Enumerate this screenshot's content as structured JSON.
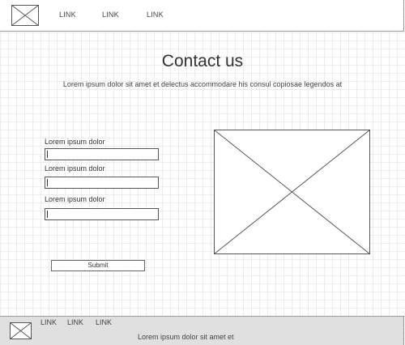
{
  "header": {
    "links": [
      "LINK",
      "LINK",
      "LINK"
    ]
  },
  "main": {
    "title": "Contact us",
    "subtitle": "Lorem ipsum dolor sit amet et delectus accommodare his consul copiosae legendos at",
    "form": {
      "fields": [
        {
          "label": "Lorem ipsum dolor",
          "value": ""
        },
        {
          "label": "Lorem ipsum dolor",
          "value": ""
        },
        {
          "label": "Lorem ipsum dolor",
          "value": ""
        }
      ],
      "submit_label": "Submit"
    },
    "image_placeholder": "image-placeholder-icon"
  },
  "footer": {
    "links": [
      "LINK",
      "LINK",
      "LINK"
    ],
    "text": "Lorem ipsum dolor sit amet et"
  },
  "icons": {
    "logo": "image-placeholder-icon"
  }
}
